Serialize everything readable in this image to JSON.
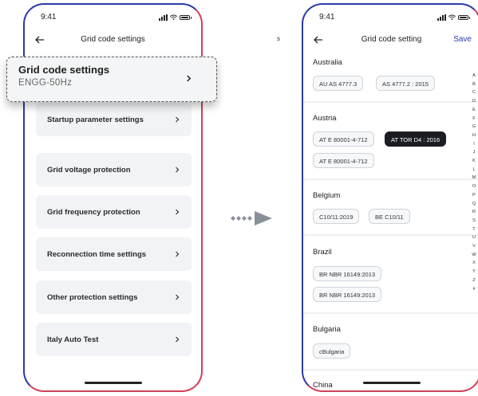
{
  "status": {
    "time": "9:41"
  },
  "left": {
    "nav_title": "Grid code settings",
    "highlight": {
      "title": "Grid code settings",
      "value": "ENGG-50Hz"
    },
    "items": [
      {
        "label": "Startup parameter settings"
      },
      {
        "label": "Grid voltage protection"
      },
      {
        "label": "Grid frequency protection"
      },
      {
        "label": "Reconnection time settings"
      },
      {
        "label": "Other protection settings"
      },
      {
        "label": "Italy Auto Test"
      }
    ]
  },
  "stray_char": "s",
  "right": {
    "nav_title": "Grid code setting",
    "save_label": "Save",
    "countries": [
      {
        "name": "Australia",
        "codes": [
          "AU AS 4777.3",
          "AS 4777.2 : 2015"
        ]
      },
      {
        "name": "Austria",
        "codes": [
          "AT E 80001-4-712",
          "AT TOR D4 : 2016",
          "AT E 80001-4-712"
        ],
        "selected": "AT TOR D4 : 2016"
      },
      {
        "name": "Belgium",
        "codes": [
          "C10/11:2019",
          "BE C10/11"
        ]
      },
      {
        "name": "Brazil",
        "codes": [
          "BR NBR 16149:2013",
          "BR NBR 16149:2013"
        ]
      },
      {
        "name": "Bulgaria",
        "codes": [
          "cBulgaria"
        ]
      },
      {
        "name": "China",
        "codes": []
      }
    ],
    "alphabet": [
      "A",
      "B",
      "C",
      "D",
      "E",
      "F",
      "G",
      "H",
      "I",
      "J",
      "K",
      "L",
      "M",
      "O",
      "P",
      "Q",
      "R",
      "S",
      "T",
      "U",
      "V",
      "W",
      "X",
      "Y",
      "Z",
      "#"
    ]
  },
  "colors": {
    "accent": "#2a3aa8",
    "frame_right": "#d0405a",
    "selected_chip": "#1b1d22",
    "arrow": "#8a8f99"
  }
}
